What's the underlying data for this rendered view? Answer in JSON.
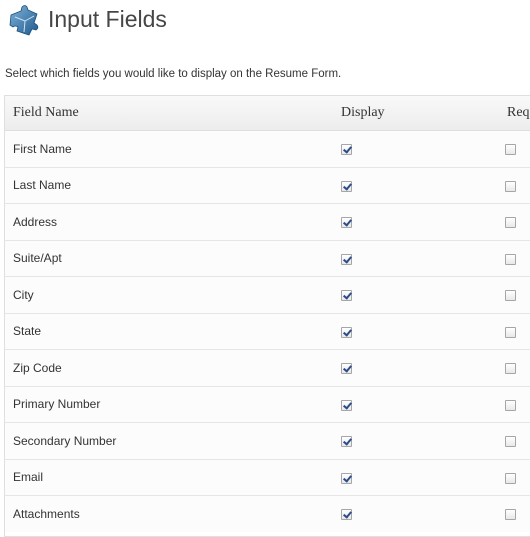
{
  "header": {
    "title": "Input Fields",
    "icon": "puzzle-piece-icon"
  },
  "description": "Select which fields you would like to display on the Resume Form.",
  "table": {
    "columns": [
      "Field Name",
      "Display",
      "Req"
    ],
    "rows": [
      {
        "field": "First Name",
        "display": true,
        "required": false
      },
      {
        "field": "Last Name",
        "display": true,
        "required": false
      },
      {
        "field": "Address",
        "display": true,
        "required": false
      },
      {
        "field": "Suite/Apt",
        "display": true,
        "required": false
      },
      {
        "field": "City",
        "display": true,
        "required": false
      },
      {
        "field": "State",
        "display": true,
        "required": false
      },
      {
        "field": "Zip Code",
        "display": true,
        "required": false
      },
      {
        "field": "Primary Number",
        "display": true,
        "required": false
      },
      {
        "field": "Secondary Number",
        "display": true,
        "required": false
      },
      {
        "field": "Email",
        "display": true,
        "required": false
      },
      {
        "field": "Attachments",
        "display": true,
        "required": false
      }
    ]
  },
  "colors": {
    "accent": "#2f6fa8",
    "border": "#dfdfdf"
  }
}
